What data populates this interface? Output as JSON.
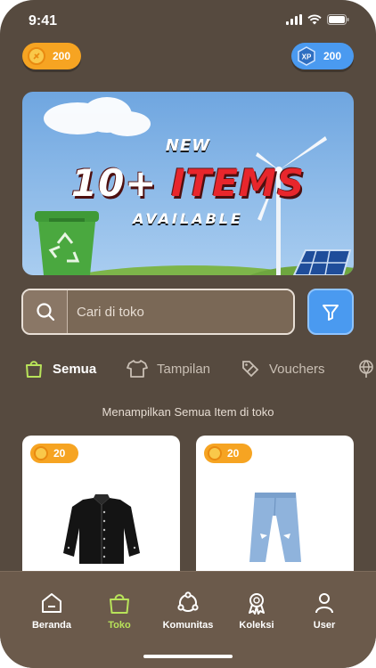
{
  "status_bar": {
    "time": "9:41"
  },
  "currency": {
    "coins": "200",
    "xp_label": "XP",
    "xp": "200"
  },
  "banner": {
    "line1": "NEW",
    "count": "10+",
    "items": "ITEMS",
    "line3": "AVAILABLE"
  },
  "search": {
    "placeholder": "Cari di toko",
    "value": ""
  },
  "tabs": [
    {
      "label": "Semua",
      "icon": "shopping-bag-icon",
      "active": true
    },
    {
      "label": "Tampilan",
      "icon": "shirt-icon",
      "active": false
    },
    {
      "label": "Vouchers",
      "icon": "voucher-icon",
      "active": false
    }
  ],
  "info_text": "Menampilkan Semua Item di toko",
  "products": [
    {
      "price": "20",
      "item": "black-jacket"
    },
    {
      "price": "20",
      "item": "ripped-jeans"
    }
  ],
  "nav": [
    {
      "label": "Beranda",
      "icon": "home-icon",
      "active": false
    },
    {
      "label": "Toko",
      "icon": "shopping-bag-icon",
      "active": true
    },
    {
      "label": "Komunitas",
      "icon": "community-icon",
      "active": false
    },
    {
      "label": "Koleksi",
      "icon": "award-icon",
      "active": false
    },
    {
      "label": "User",
      "icon": "user-icon",
      "active": false
    }
  ],
  "colors": {
    "background": "#564a3f",
    "coin": "#f6a422",
    "xp": "#4a9af0",
    "active_nav": "#b8e35a"
  }
}
